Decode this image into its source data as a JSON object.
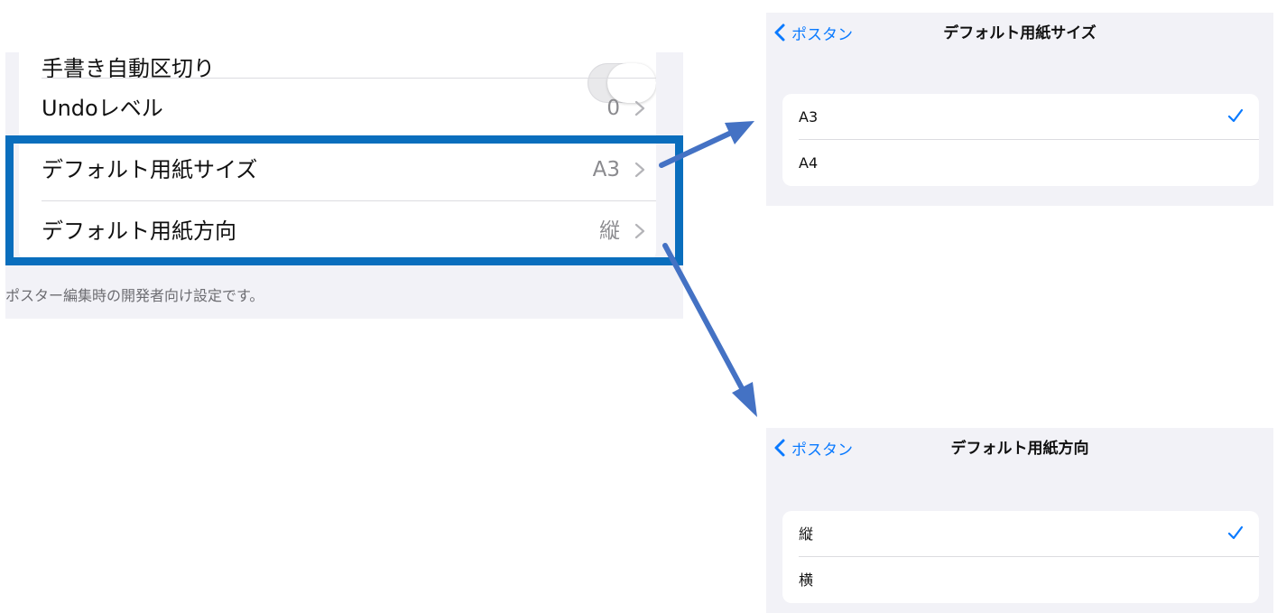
{
  "settings": {
    "partial_row_label": "手書き自動区切り",
    "rows": [
      {
        "label": "Undoレベル",
        "value": "0"
      },
      {
        "label": "デフォルト用紙サイズ",
        "value": "A3"
      },
      {
        "label": "デフォルト用紙方向",
        "value": "縦"
      }
    ],
    "footer": "ポスター編集時の開発者向け設定です。"
  },
  "paper_size_screen": {
    "back_label": "ポスタン",
    "title": "デフォルト用紙サイズ",
    "options": [
      {
        "label": "A3",
        "selected": true
      },
      {
        "label": "A4",
        "selected": false
      }
    ]
  },
  "orientation_screen": {
    "back_label": "ポスタン",
    "title": "デフォルト用紙方向",
    "options": [
      {
        "label": "縦",
        "selected": true
      },
      {
        "label": "横",
        "selected": false
      }
    ]
  },
  "colors": {
    "highlight": "#0a6ebd",
    "arrow": "#4472c4",
    "ios_blue": "#0a7aff"
  }
}
